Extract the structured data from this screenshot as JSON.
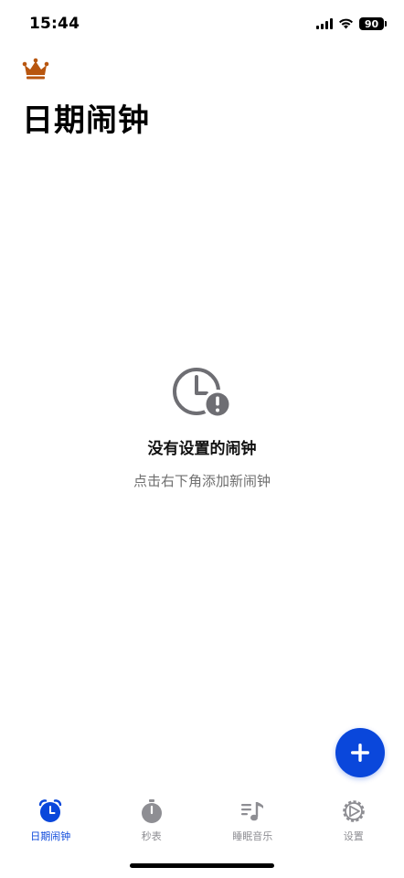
{
  "status_bar": {
    "time": "15:44",
    "battery": "90",
    "icons": [
      "signal-icon",
      "wifi-icon",
      "battery-icon"
    ]
  },
  "header": {
    "crown_icon": "crown-icon",
    "crown_color": "#b8560f",
    "title": "日期闹钟"
  },
  "empty_state": {
    "icon": "clock-alert-icon",
    "title": "没有设置的闹钟",
    "subtitle": "点击右下角添加新闹钟"
  },
  "fab": {
    "icon": "plus-icon",
    "color": "#0a47db"
  },
  "tab_bar": {
    "active_color": "#0a47db",
    "inactive_color": "#8e8e93",
    "tabs": [
      {
        "label": "日期闹钟",
        "icon": "alarm-clock-icon",
        "active": true
      },
      {
        "label": "秒表",
        "icon": "stopwatch-icon",
        "active": false
      },
      {
        "label": "睡眠音乐",
        "icon": "music-list-icon",
        "active": false
      },
      {
        "label": "设置",
        "icon": "gear-icon",
        "active": false
      }
    ]
  }
}
